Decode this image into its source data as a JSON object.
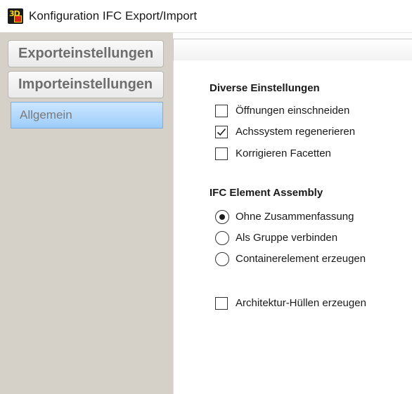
{
  "window": {
    "title": "Konfiguration IFC Export/Import"
  },
  "nav": {
    "export_label": "Exporteinstellungen",
    "import_label": "Importeinstellungen",
    "items": [
      {
        "label": "Allgemein",
        "selected": true
      }
    ]
  },
  "misc": {
    "heading": "Diverse Einstellungen",
    "options": [
      {
        "label": "Öffnungen einschneiden",
        "checked": false
      },
      {
        "label": "Achssystem regenerieren",
        "checked": true
      },
      {
        "label": "Korrigieren Facetten",
        "checked": false
      }
    ]
  },
  "assembly": {
    "heading": "IFC Element Assembly",
    "options": [
      {
        "label": "Ohne Zusammenfassung",
        "selected": true
      },
      {
        "label": "Als Gruppe verbinden",
        "selected": false
      },
      {
        "label": "Containerelement erzeugen",
        "selected": false
      }
    ]
  },
  "extra": {
    "label": "Architektur-Hüllen erzeugen",
    "checked": false
  },
  "colors": {
    "nav_bg": "#d5d0c8",
    "selected_item": "#9ccdfa"
  }
}
